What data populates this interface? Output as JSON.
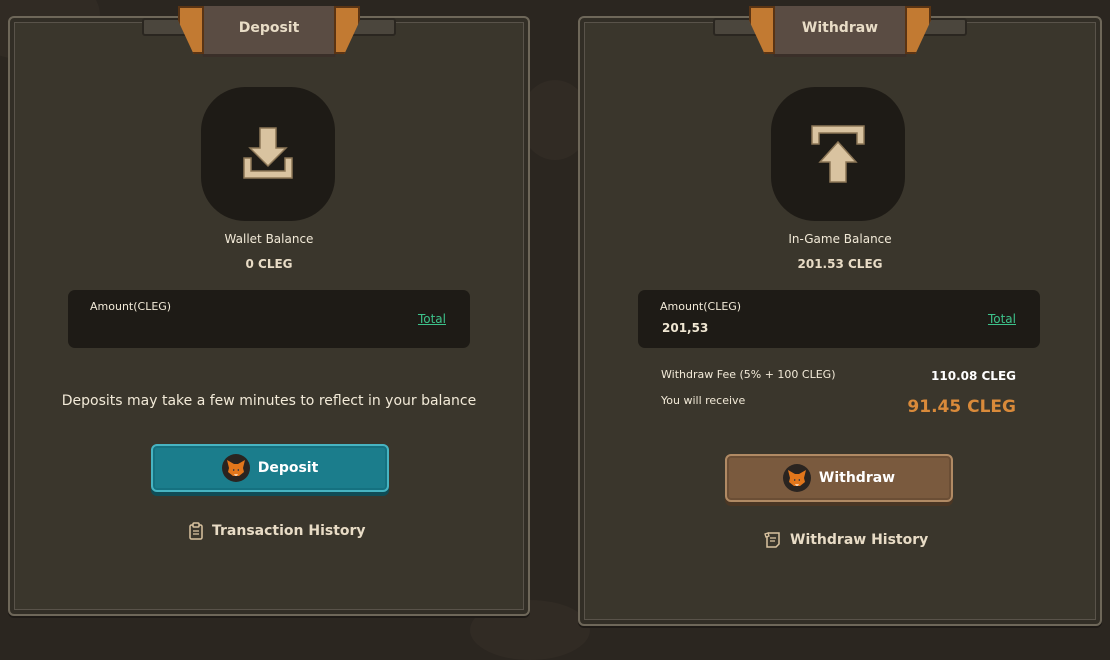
{
  "deposit": {
    "tab_title": "Deposit",
    "icon": "download-icon",
    "balance_label": "Wallet Balance",
    "balance_value": "0 CLEG",
    "amount_label": "Amount(CLEG)",
    "amount_value": "",
    "total_link": "Total",
    "note": "Deposits may take a few minutes to reflect in your balance",
    "button_label": "Deposit",
    "history_label": "Transaction History"
  },
  "withdraw": {
    "tab_title": "Withdraw",
    "icon": "upload-icon",
    "balance_label": "In-Game Balance",
    "balance_value": "201.53 CLEG",
    "amount_label": "Amount(CLEG)",
    "amount_value": "201,53",
    "total_link": "Total",
    "fee_label": "Withdraw Fee (5% + 100 CLEG)",
    "fee_value": "110.08 CLEG",
    "receive_label": "You will receive",
    "receive_value": "91.45 CLEG",
    "button_label": "Withdraw",
    "history_label": "Withdraw History"
  },
  "colors": {
    "accent_link": "#3dc28a",
    "deposit_button": "#1b7d8c",
    "withdraw_button": "#7a5a3e",
    "receive_value": "#d98a3a"
  }
}
